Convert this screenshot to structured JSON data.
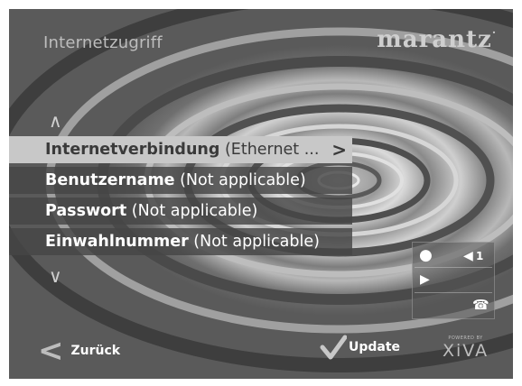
{
  "header": {
    "title": "Internetzugriff",
    "logo": "marantz",
    "logo_dot": "·"
  },
  "nav": {
    "up_glyph": "∧",
    "down_glyph": "∨"
  },
  "menu": {
    "items": [
      {
        "name": "Internetverbindung",
        "value": " (Ethernet  ...",
        "arrow": ">",
        "selected": true
      },
      {
        "name": "Benutzername",
        "value": " (Not applicable)"
      },
      {
        "name": "Passwort",
        "value": " (Not applicable)"
      },
      {
        "name": "Einwahlnummer",
        "value": " (Not applicable)"
      }
    ]
  },
  "status": {
    "record_glyph": "●",
    "volume_glyph": "◀",
    "volume_level": "1",
    "play_glyph": "▶",
    "phone_glyph": "☎"
  },
  "footer": {
    "back_glyph": "<",
    "back_label": "Zurück",
    "update_label": "Update",
    "powered_by": "POWERED BY",
    "brand": "XiVA"
  },
  "colors": {
    "selected_bg": "#c8c8c8",
    "row_bg": "#464646",
    "text": "#ffffff"
  }
}
